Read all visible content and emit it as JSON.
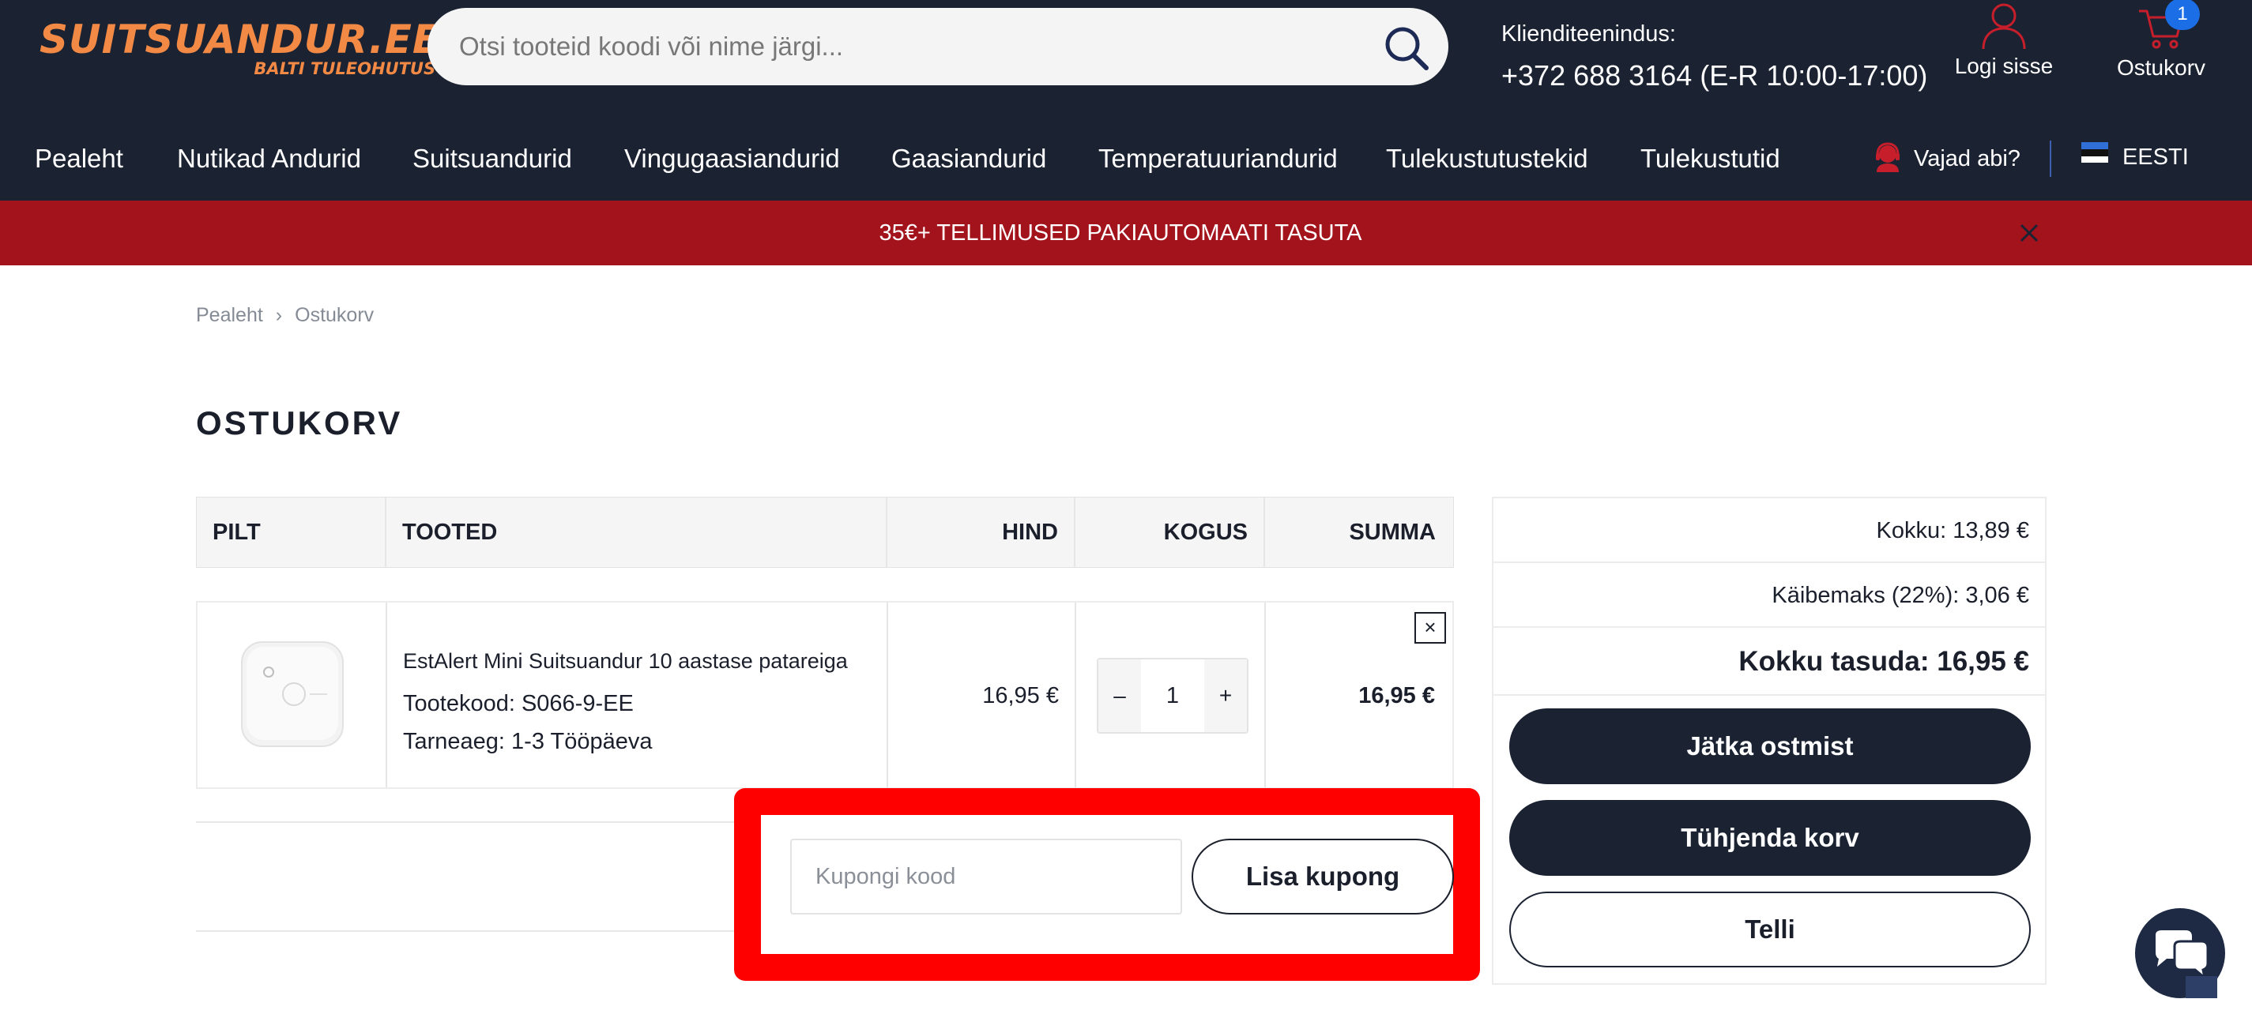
{
  "brand": {
    "name": "SUITSUANDUR.EE",
    "tagline": "BALTI TULEOHUTUS",
    "color": "#f28a45"
  },
  "search": {
    "placeholder": "Otsi tooteid koodi või nime järgi...",
    "icon": "search-icon"
  },
  "customer_service": {
    "label": "Klienditeenindus:",
    "phone": "+372 688 3164 (E-R 10:00-17:00)"
  },
  "account": {
    "label": "Logi sisse",
    "icon": "user-icon"
  },
  "cart": {
    "label": "Ostukorv",
    "count": "1",
    "icon": "cart-icon"
  },
  "nav": {
    "items": [
      "Pealeht",
      "Nutikad Andurid",
      "Suitsuandurid",
      "Vingugaasiandurid",
      "Gaasiandurid",
      "Temperatuuriandurid",
      "Tulekustutustekid",
      "Tulekustutid"
    ],
    "help_label": "Vajad abi?",
    "language": "EESTI"
  },
  "promo": {
    "text": "35€+ TELLIMUSED PAKIAUTOMAATI TASUTA",
    "background": "#a3131c"
  },
  "breadcrumb": {
    "home": "Pealeht",
    "current": "Ostukorv"
  },
  "page_title": "OSTUKORV",
  "table": {
    "headers": {
      "image": "PILT",
      "product": "TOOTED",
      "price": "HIND",
      "quantity": "KOGUS",
      "total": "SUMMA"
    },
    "rows": [
      {
        "name": "EstAlert Mini Suitsuandur 10 aastase patareiga",
        "code": "Tootekood: S066-9-EE",
        "delivery": "Tarneaeg: 1-3 Tööpäeva",
        "price": "16,95 €",
        "quantity": "1",
        "total": "16,95 €",
        "remove": "×"
      }
    ]
  },
  "coupon": {
    "placeholder": "Kupongi kood",
    "button": "Lisa kupong",
    "highlight_color": "#ff0000"
  },
  "summary": {
    "subtotal": "Kokku: 13,89 €",
    "vat": "Käibemaks (22%): 3,06 €",
    "total": "Kokku tasuda: 16,95 €",
    "continue_button": "Jätka ostmist",
    "empty_button": "Tühjenda korv",
    "order_button": "Telli"
  },
  "colors": {
    "header_bg": "#1b2232",
    "accent_blue": "#1b6ee6"
  }
}
